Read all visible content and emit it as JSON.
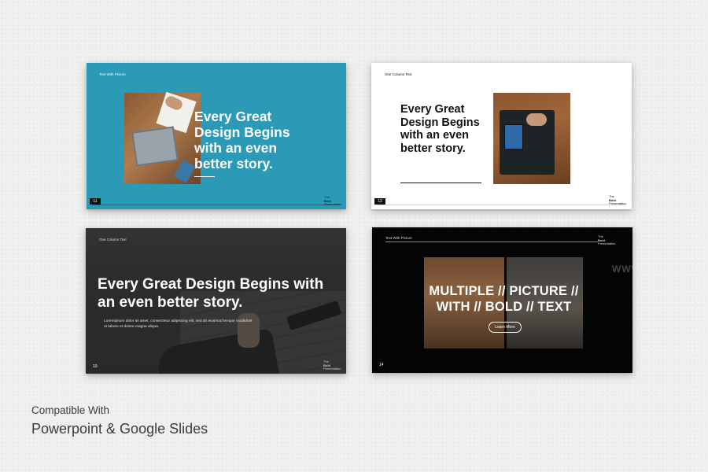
{
  "slides": [
    {
      "header": "Text With Picture",
      "headline": "Every Great Design Begins with an even better story.",
      "number": "11",
      "brand": [
        "The",
        "Bold",
        "Presentation"
      ]
    },
    {
      "header": "One Column Text",
      "headline": "Every Great Design Begins with an even better story.",
      "number": "12",
      "brand": [
        "The",
        "Bold",
        "Presentation"
      ]
    },
    {
      "header": "One Column Text",
      "headline": "Every Great Design Begins with an even better story.",
      "body": "Loremipsum dolor sit amet, consectetur adipiscing elit, sed do eiusmod tempor incididunt ut labore et dolore magna aliqua.",
      "number": "10",
      "brand": [
        "The",
        "Bold",
        "Presentation"
      ]
    },
    {
      "header": "Text With Picture",
      "headline": "MULTIPLE // PICTURE // WITH // BOLD // TEXT",
      "button": "Learn More",
      "number": "14",
      "brand": [
        "The",
        "Bold",
        "Presentation"
      ],
      "watermark": "WWW"
    }
  ],
  "caption": {
    "line1": "Compatible With",
    "line2": "Powerpoint & Google Slides"
  },
  "colors": {
    "slide1_bg": "#2a9ab6",
    "slide2_bg": "#ffffff",
    "slide4_bg": "#050505",
    "page_bg": "#efefed"
  }
}
